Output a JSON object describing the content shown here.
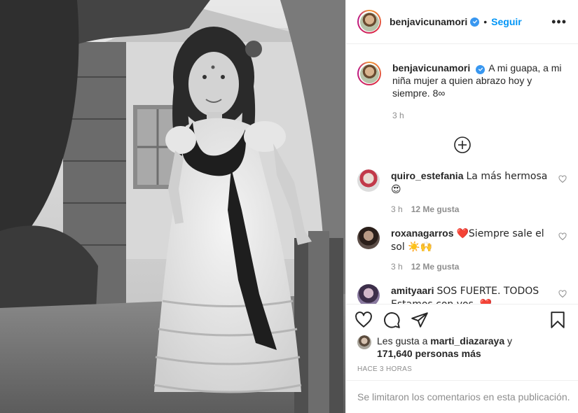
{
  "header": {
    "username": "benjavicunamori",
    "separator": "•",
    "follow_label": "Seguir",
    "more_label": "•••"
  },
  "caption": {
    "username": "benjavicunamori",
    "text": "A mi guapa, a mi niña mujer a quien abrazo hoy y siempre. 8∞",
    "time": "3 h"
  },
  "comments": [
    {
      "username": "quiro_estefania",
      "text": "La más hermosa 😍",
      "time": "3 h",
      "likes": "12 Me gusta",
      "avatar_color": "#d9d3cc"
    },
    {
      "username": "roxanagarros",
      "text": "❤️Siempre sale el sol ☀️🙌",
      "time": "3 h",
      "likes": "12 Me gusta",
      "avatar_color": "#3b2f2a"
    },
    {
      "username": "amityaari",
      "text": "SOS FUERTE. TODOS Estamos con vos. ❤️",
      "time": "",
      "likes": "",
      "avatar_color": "#5a4b66"
    }
  ],
  "likes": {
    "prefix": "Les gusta a",
    "user": "marti_diazaraya",
    "connector": "y",
    "count": "171,640 personas más"
  },
  "posted_ago": "HACE 3 HORAS",
  "footer_text": "Se limitaron los comentarios en esta publicación.",
  "colors": {
    "link": "#0095f6",
    "verified": "#3897f0",
    "muted": "#8e8e8e",
    "border": "#efefef"
  },
  "icons": [
    "verified-icon",
    "plus-circle-icon",
    "heart-icon",
    "comment-icon",
    "share-icon",
    "bookmark-icon"
  ]
}
